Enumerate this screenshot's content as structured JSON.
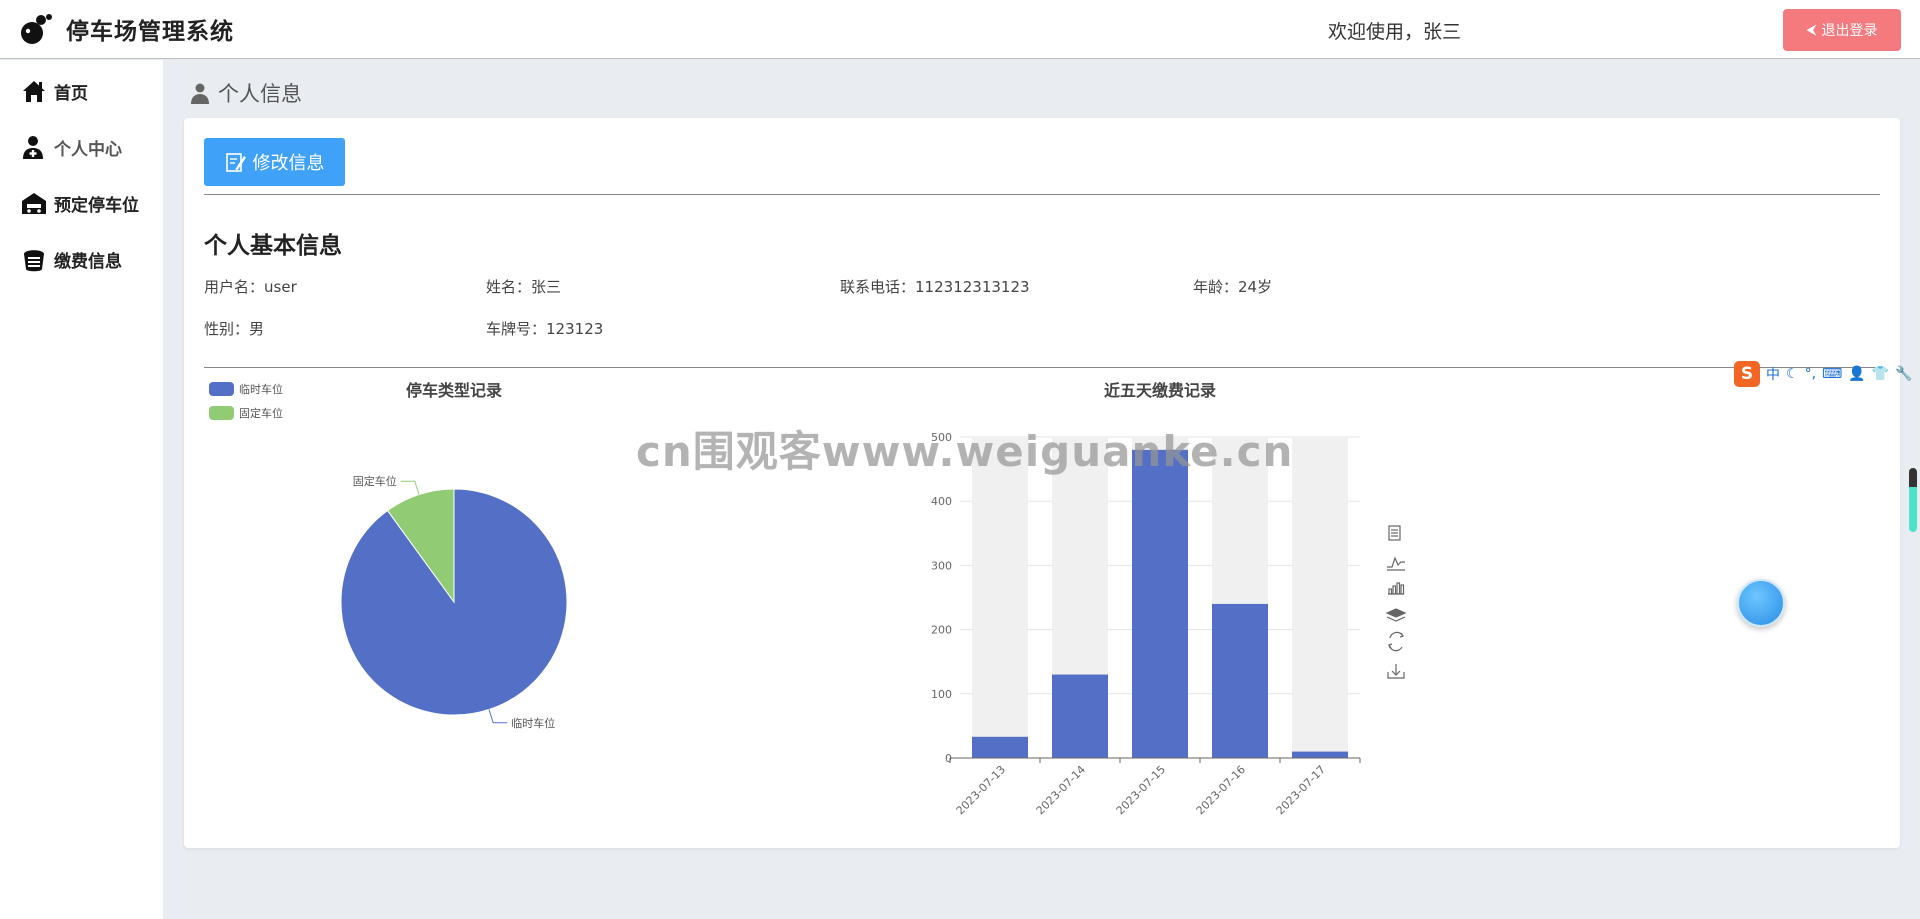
{
  "header": {
    "app_title": "停车场管理系统",
    "welcome": "欢迎使用，张三",
    "logout_label": "退出登录"
  },
  "sidebar": {
    "items": [
      {
        "label": "首页",
        "icon": "home-icon"
      },
      {
        "label": "个人中心",
        "icon": "user-plus-icon"
      },
      {
        "label": "预定停车位",
        "icon": "garage-icon"
      },
      {
        "label": "缴费信息",
        "icon": "payment-icon"
      }
    ],
    "active_index": 1
  },
  "breadcrumb": {
    "title": "个人信息"
  },
  "profile": {
    "edit_label": "修改信息",
    "section_title": "个人基本信息",
    "fields": [
      {
        "label": "用户名：",
        "value": "user"
      },
      {
        "label": "姓名：",
        "value": "张三"
      },
      {
        "label": "联系电话：",
        "value": "112312313123"
      },
      {
        "label": "年龄：",
        "value": "24岁"
      },
      {
        "label": "性别：",
        "value": "男"
      },
      {
        "label": "车牌号：",
        "value": "123123"
      }
    ]
  },
  "chart_data": [
    {
      "type": "pie",
      "title": "停车类型记录",
      "legend_position": "top-left",
      "slices": [
        {
          "name": "临时车位",
          "value": 90,
          "color": "#5470c6"
        },
        {
          "name": "固定车位",
          "value": 10,
          "color": "#91cc75"
        }
      ]
    },
    {
      "type": "bar",
      "title": "近五天缴费记录",
      "categories": [
        "2023-07-13",
        "2023-07-14",
        "2023-07-15",
        "2023-07-16",
        "2023-07-17"
      ],
      "values": [
        33,
        130,
        480,
        240,
        10
      ],
      "ylim": [
        0,
        500
      ],
      "yticks": [
        0,
        100,
        200,
        300,
        400,
        500
      ],
      "grid": true,
      "background_bars": true,
      "color": "#5470c6",
      "toolbox": [
        "data-view-icon",
        "line-chart-icon",
        "bar-chart-icon",
        "stack-icon",
        "restore-icon",
        "download-icon"
      ]
    }
  ],
  "watermark": "cn围观客www.weiguanke.cn",
  "ime": {
    "mode_label": "中"
  }
}
